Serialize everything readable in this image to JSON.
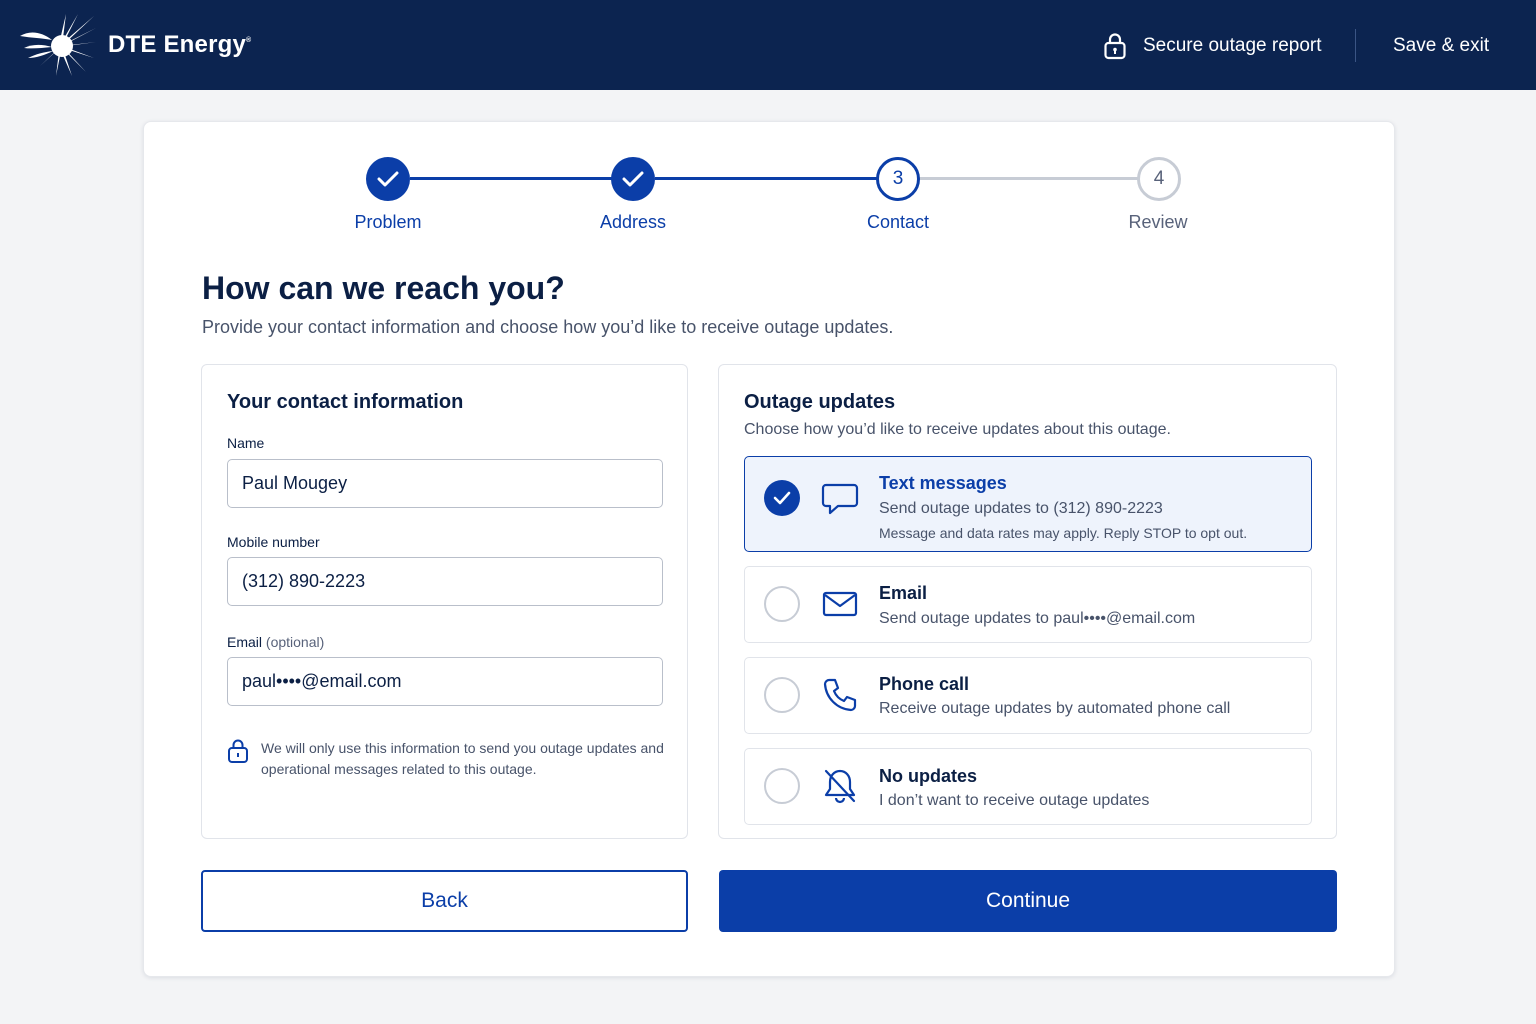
{
  "header": {
    "brand": "DTE Energy",
    "brand_mark": "®",
    "secure_label": "Secure outage report",
    "save_exit_label": "Save & exit"
  },
  "stepper": {
    "steps": [
      {
        "label": "Problem",
        "number": "1",
        "status": "complete"
      },
      {
        "label": "Address",
        "number": "2",
        "status": "complete"
      },
      {
        "label": "Contact",
        "number": "3",
        "status": "current"
      },
      {
        "label": "Review",
        "number": "4",
        "status": "upcoming"
      }
    ]
  },
  "page": {
    "title": "How can we reach you?",
    "subtitle": "Provide your contact information and choose how you’d like to receive outage updates."
  },
  "contact": {
    "title": "Your contact information",
    "name_label": "Name",
    "name_value": "Paul Mougey",
    "mobile_label": "Mobile number",
    "mobile_value": "(312) 890-2223",
    "email_label": "Email",
    "email_optional": "(optional)",
    "email_value": "paul••••@email.com",
    "privacy_note": "We will only use this information to send you outage updates and operational messages related to this outage."
  },
  "updates": {
    "title": "Outage updates",
    "subtitle": "Choose how you’d like to receive updates about this outage.",
    "options": [
      {
        "title": "Text messages",
        "desc": "Send outage updates to (312) 890-2223",
        "note": "Message and data rates may apply. Reply STOP to opt out.",
        "icon": "chat-bubble-icon",
        "selected": true
      },
      {
        "title": "Email",
        "desc": "Send outage updates to paul••••@email.com",
        "icon": "envelope-icon",
        "selected": false
      },
      {
        "title": "Phone call",
        "desc": "Receive outage updates by automated phone call",
        "icon": "phone-icon",
        "selected": false
      },
      {
        "title": "No updates",
        "desc": "I don’t want to receive outage updates",
        "icon": "bell-off-icon",
        "selected": false
      }
    ]
  },
  "actions": {
    "back_label": "Back",
    "continue_label": "Continue"
  },
  "colors": {
    "header_bg": "#0c2450",
    "primary": "#0b3ea8",
    "text": "#0b1f44",
    "muted": "#48536a"
  }
}
